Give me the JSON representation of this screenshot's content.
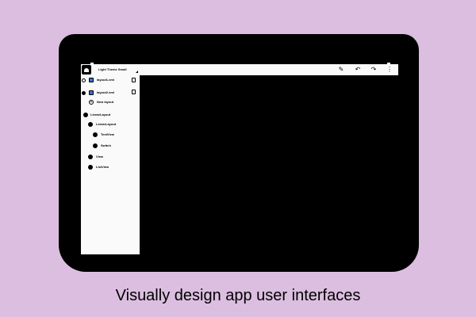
{
  "actionbar": {
    "theme": "Light Theme Small",
    "tools": [
      {
        "icon": "pencil-icon",
        "glyph": "✎"
      },
      {
        "icon": "undo-icon",
        "glyph": "↶"
      },
      {
        "icon": "redo-icon",
        "glyph": "↷"
      },
      {
        "icon": "overflow-menu-icon",
        "glyph": "⋮"
      }
    ]
  },
  "panel": {
    "layouts": [
      {
        "label": "layout1.xml",
        "selected": false,
        "icon": "layout-file-icon"
      },
      {
        "label": "layout2.xml",
        "selected": true,
        "icon": "layout-file-icon"
      },
      {
        "label": "New layout",
        "selected": false,
        "icon": "add-layout-icon"
      }
    ],
    "tree": [
      {
        "label": "LinearLayout",
        "depth": 0
      },
      {
        "label": "LinearLayout",
        "depth": 1
      },
      {
        "label": "TextView",
        "depth": 2
      },
      {
        "label": "Switch",
        "depth": 2
      },
      {
        "label": "View",
        "depth": 1
      },
      {
        "label": "ListView",
        "depth": 1
      }
    ]
  },
  "caption": "Visually design app user interfaces"
}
